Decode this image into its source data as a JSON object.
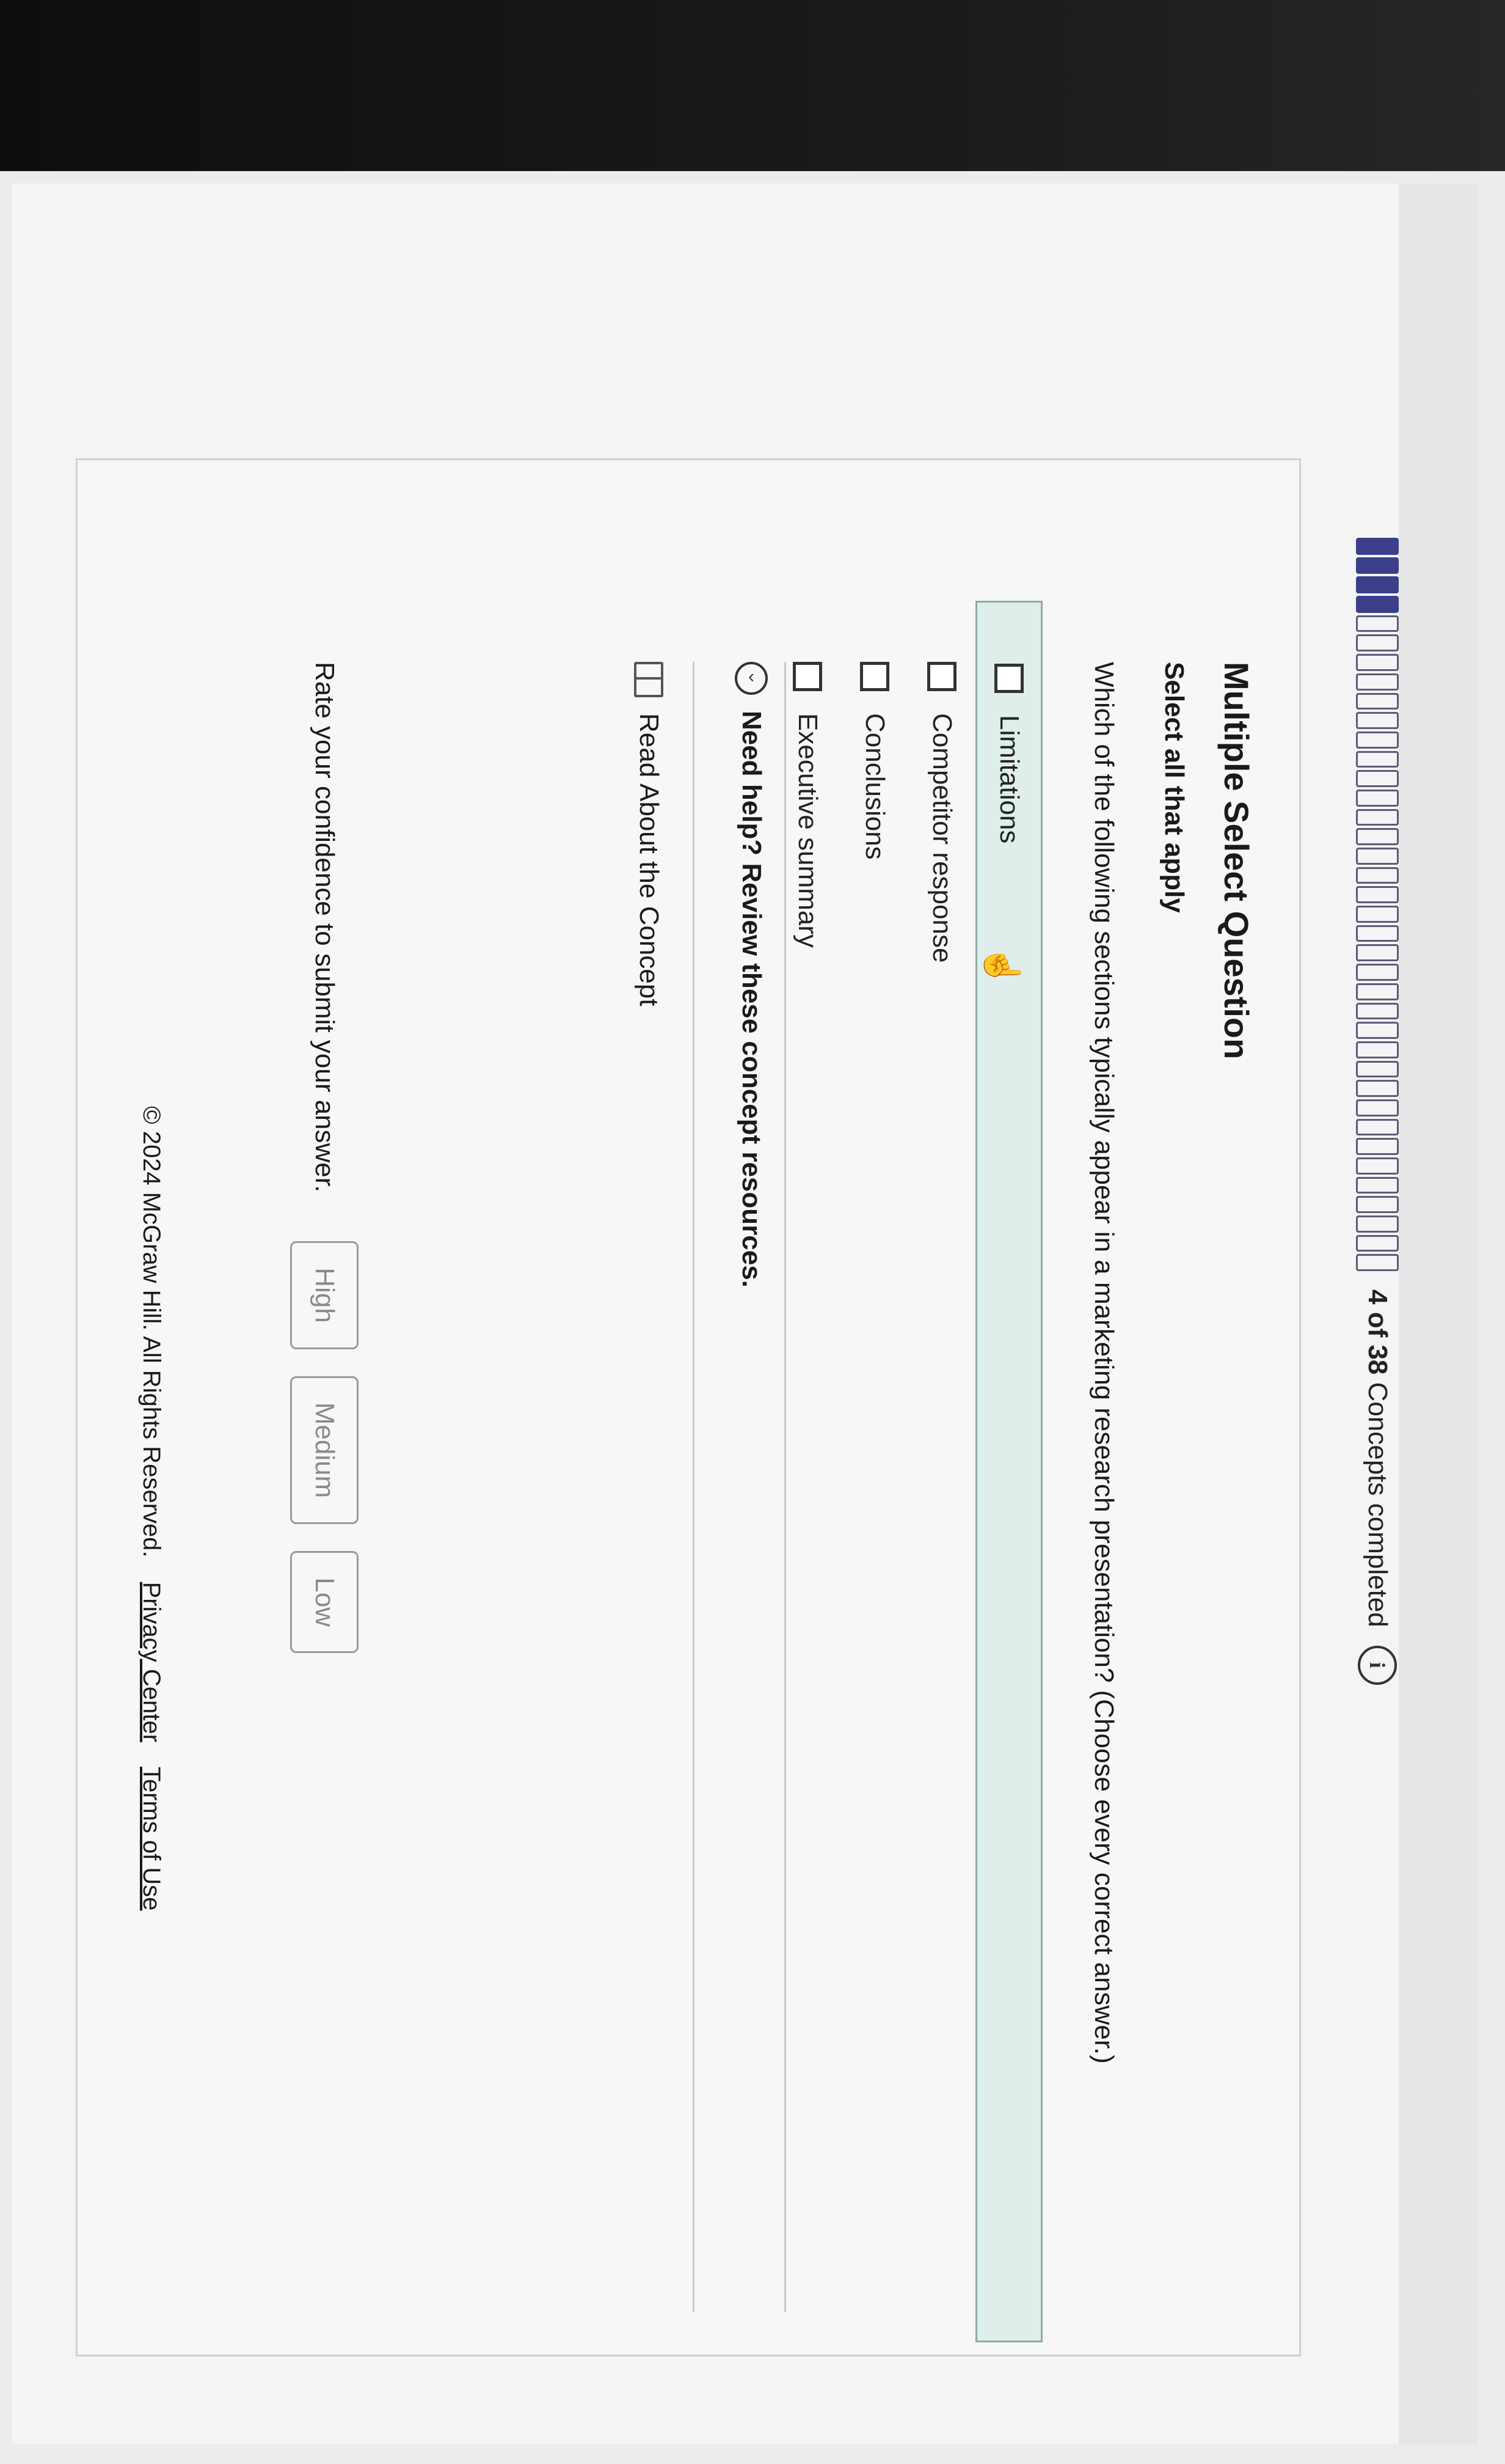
{
  "progress": {
    "segments_total": 38,
    "segments_done": 4,
    "count_label": "4 of 38",
    "suffix_label": "Concepts completed",
    "info_icon": "i"
  },
  "question": {
    "type": "Multiple Select Question",
    "instruction": "Select all that apply",
    "text": "Which of the following sections typically appear in a marketing research presentation? (Choose every correct answer.)",
    "options": [
      {
        "label": "Limitations",
        "checked": false
      },
      {
        "label": "Competitor response",
        "checked": false
      },
      {
        "label": "Conclusions",
        "checked": false
      },
      {
        "label": "Executive summary",
        "checked": false
      }
    ]
  },
  "help": {
    "label": "Need help? Review these concept resources.",
    "icon": "chevron-circle-icon"
  },
  "resources": {
    "read_label": "Read About the Concept",
    "icon": "book-icon"
  },
  "confidence": {
    "prompt": "Rate your confidence to submit your answer.",
    "high": "High",
    "medium": "Medium",
    "low": "Low"
  },
  "footer": {
    "copyright": "© 2024 McGraw Hill. All Rights Reserved.",
    "privacy": "Privacy Center",
    "terms": "Terms of Use"
  }
}
